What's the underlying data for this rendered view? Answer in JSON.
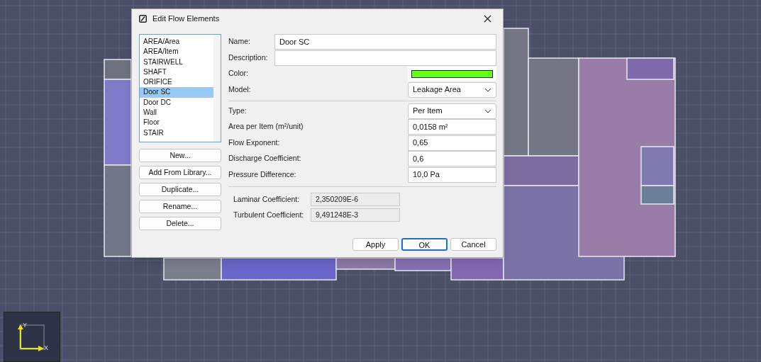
{
  "dialog": {
    "title": "Edit Flow Elements",
    "elements": [
      {
        "label": "AREA/Area",
        "selected": false
      },
      {
        "label": "AREA/Item",
        "selected": false
      },
      {
        "label": "STAIRWELL",
        "selected": false
      },
      {
        "label": "SHAFT",
        "selected": false
      },
      {
        "label": "ORIFICE",
        "selected": false
      },
      {
        "label": "Door SC",
        "selected": true
      },
      {
        "label": "Door DC",
        "selected": false
      },
      {
        "label": "Wall",
        "selected": false
      },
      {
        "label": "Floor",
        "selected": false
      },
      {
        "label": "STAIR",
        "selected": false
      }
    ],
    "side_buttons": [
      "New...",
      "Add From Library...",
      "Duplicate...",
      "Rename...",
      "Delete..."
    ],
    "field_groups": [
      [
        {
          "kind": "wide",
          "label": "Name:",
          "value": "Door SC"
        },
        {
          "kind": "wide",
          "label": "Description:"
        },
        {
          "kind": "color",
          "label": "Color:",
          "color": "#66ff1a"
        },
        {
          "kind": "select",
          "label": "Model:",
          "value": "Leakage Area"
        }
      ],
      [
        {
          "kind": "select",
          "label": "Type:",
          "value": "Per Item"
        },
        {
          "kind": "text",
          "label": "Area per Item (m²/unit)",
          "value": "0,0158 m²"
        },
        {
          "kind": "text",
          "label": "Flow Exponent:",
          "value": "0,65"
        },
        {
          "kind": "text",
          "label": "Discharge Coefficient:",
          "value": "0,6"
        },
        {
          "kind": "text",
          "label": "Pressure Difference:",
          "value": "10,0 Pa"
        }
      ]
    ],
    "coefficients": [
      {
        "label": "Laminar Coefficient:",
        "value": "2,350209E-6"
      },
      {
        "label": "Turbulent Coefficient:",
        "value": "9,491248E-3"
      }
    ],
    "buttons": [
      {
        "label": "Apply",
        "default": false
      },
      {
        "label": "OK",
        "default": true
      },
      {
        "label": "Cancel",
        "default": false
      }
    ]
  },
  "axis_widget": {
    "y_label": "Y",
    "x_label": "X"
  }
}
